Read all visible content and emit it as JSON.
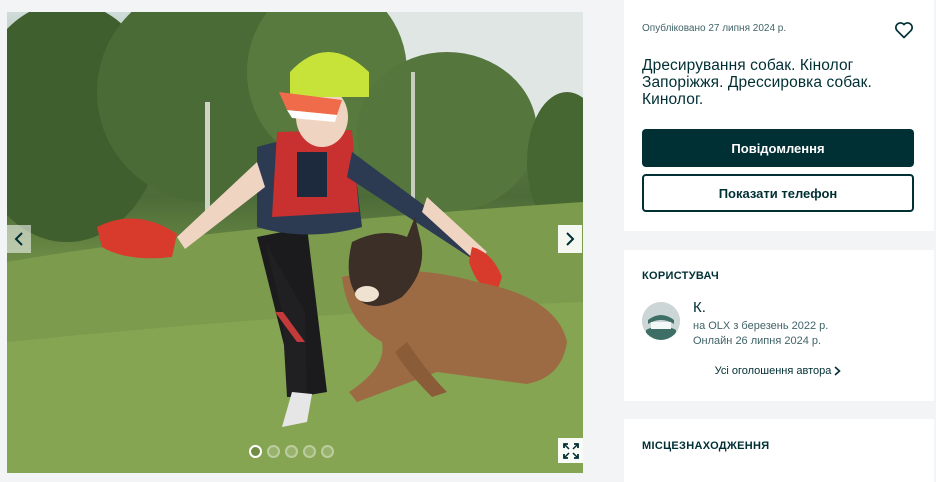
{
  "gallery": {
    "image_alt": "Дівчина з вівчаркою під час дресирування",
    "dots_count": 5,
    "active_dot": 1
  },
  "ad": {
    "published": "Опубліковано 27 липня 2024 р.",
    "title": "Дресирування собак. Кінолог Запоріжжя. Дрессировка собак. Кинолог.",
    "message_button": "Повідомлення",
    "phone_button": "Показати телефон"
  },
  "user": {
    "section_title": "КОРИСТУВАЧ",
    "name": "К.",
    "member_since": "на OLX з березень 2022 р.",
    "last_online": "Онлайн 26 липня 2024 р.",
    "all_ads_link": "Усі оголошення автора"
  },
  "location": {
    "section_title": "МІСЦЕЗНАХОДЖЕННЯ"
  },
  "colors": {
    "brand_dark": "#002f34",
    "background": "#f2f4f5",
    "muted_text": "#406367"
  },
  "icons": {
    "favorite": "heart-icon",
    "prev": "chevron-left-icon",
    "next": "chevron-right-icon",
    "fullscreen": "expand-icon",
    "link_arrow": "chevron-right-icon"
  }
}
